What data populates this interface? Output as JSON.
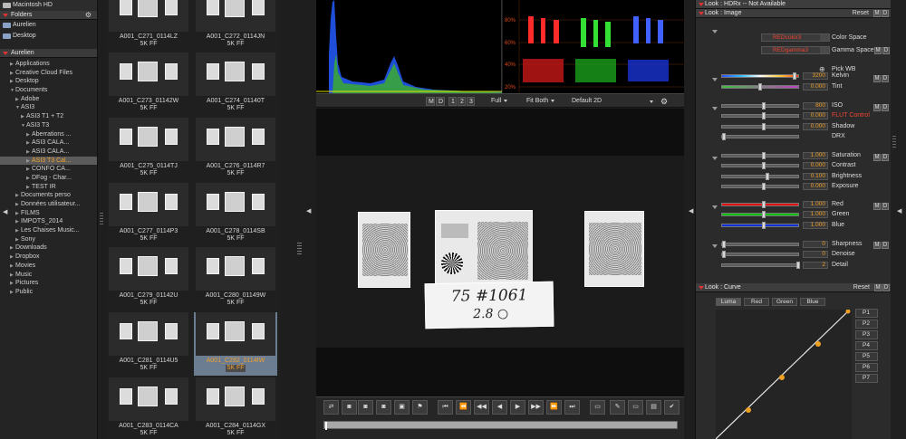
{
  "left": {
    "folders_title": "Folders",
    "volumes": [
      "Macintosh HD",
      "Aurelien",
      "Desktop"
    ],
    "user_title": "Aurelien",
    "tree": [
      {
        "label": "Applications",
        "indent": 1,
        "arrow": "▶"
      },
      {
        "label": "Creative Cloud Files",
        "indent": 1,
        "arrow": "▶"
      },
      {
        "label": "Desktop",
        "indent": 1,
        "arrow": "▶"
      },
      {
        "label": "Documents",
        "indent": 1,
        "arrow": "▼"
      },
      {
        "label": "Adobe",
        "indent": 2,
        "arrow": "▶"
      },
      {
        "label": "ASI3",
        "indent": 2,
        "arrow": "▼"
      },
      {
        "label": "ASI3 T1 + T2",
        "indent": 3,
        "arrow": "▶"
      },
      {
        "label": "ASI3 T3",
        "indent": 3,
        "arrow": "▼"
      },
      {
        "label": "Aberrations ...",
        "indent": 4,
        "arrow": "▶"
      },
      {
        "label": "ASI3 CALA...",
        "indent": 4,
        "arrow": "▶"
      },
      {
        "label": "ASI3 CALA...",
        "indent": 4,
        "arrow": "▶"
      },
      {
        "label": "ASI3 T3 Cal...",
        "indent": 4,
        "arrow": "▶",
        "selected": true
      },
      {
        "label": "CONFO CA...",
        "indent": 4,
        "arrow": "▶"
      },
      {
        "label": "DFog - Char...",
        "indent": 4,
        "arrow": "▶"
      },
      {
        "label": "TEST IR",
        "indent": 4,
        "arrow": "▶"
      },
      {
        "label": "Documents perso",
        "indent": 2,
        "arrow": "▶"
      },
      {
        "label": "Données utilisateur...",
        "indent": 2,
        "arrow": "▶"
      },
      {
        "label": "FILMS",
        "indent": 2,
        "arrow": "▶"
      },
      {
        "label": "IMPOTS_2014",
        "indent": 2,
        "arrow": "▶"
      },
      {
        "label": "Les Chaises Music...",
        "indent": 2,
        "arrow": "▶"
      },
      {
        "label": "Sony",
        "indent": 2,
        "arrow": "▶"
      },
      {
        "label": "Downloads",
        "indent": 1,
        "arrow": "▶"
      },
      {
        "label": "Dropbox",
        "indent": 1,
        "arrow": "▶"
      },
      {
        "label": "Movies",
        "indent": 1,
        "arrow": "▶"
      },
      {
        "label": "Music",
        "indent": 1,
        "arrow": "▶"
      },
      {
        "label": "Pictures",
        "indent": 1,
        "arrow": "▶"
      },
      {
        "label": "Public",
        "indent": 1,
        "arrow": "▶"
      }
    ]
  },
  "thumbs": [
    {
      "name": "A001_C271_0114LZ",
      "fmt": "5K FF"
    },
    {
      "name": "A001_C272_0114JN",
      "fmt": "5K FF"
    },
    {
      "name": "A001_C273_01142W",
      "fmt": "5K FF"
    },
    {
      "name": "A001_C274_01140T",
      "fmt": "5K FF"
    },
    {
      "name": "A001_C275_0114TJ",
      "fmt": "5K FF"
    },
    {
      "name": "A001_C276_0114R7",
      "fmt": "5K FF"
    },
    {
      "name": "A001_C277_0114P3",
      "fmt": "5K FF"
    },
    {
      "name": "A001_C278_0114SB",
      "fmt": "5K FF"
    },
    {
      "name": "A001_C279_01142U",
      "fmt": "5K FF"
    },
    {
      "name": "A001_C280_01149W",
      "fmt": "5K FF"
    },
    {
      "name": "A001_C281_0114U5",
      "fmt": "5K FF"
    },
    {
      "name": "A001_C282_0114IW",
      "fmt": "5K FF",
      "selected": true
    },
    {
      "name": "A001_C283_0114CA",
      "fmt": "5K FF"
    },
    {
      "name": "A001_C284_0114GX",
      "fmt": "5K FF"
    }
  ],
  "scopes": {
    "parade_ticks": [
      "80%",
      "60%",
      "40%",
      "20%"
    ]
  },
  "toolbar": {
    "m": "M",
    "d": "D",
    "n1": "1",
    "n2": "2",
    "n3": "3",
    "zoom": "Full",
    "fit": "Fit Both",
    "layout": "Default 2D"
  },
  "viewer": {
    "slate_line1": "75 #1061",
    "slate_line2": "2.8 ○"
  },
  "right": {
    "hdrx_title": "Look : HDRx -- Not Available",
    "image_title": "Look : Image",
    "curve_title": "Look : Curve",
    "reset": "Reset",
    "m": "M",
    "d": "D",
    "color_space_value": "REDcolor3",
    "color_space_label": "Color Space",
    "gamma_value": "REDgamma3",
    "gamma_label": "Gamma Space",
    "pick_wb": "Pick WB",
    "params": [
      {
        "label": "Kelvin",
        "value": "3200"
      },
      {
        "label": "Tint",
        "value": "0.000"
      },
      {
        "label": "ISO",
        "value": "800"
      },
      {
        "label": "FLUT Control",
        "value": "0.000",
        "red": true
      },
      {
        "label": "Shadow",
        "value": "0.000"
      },
      {
        "label": "DRX",
        "value": ""
      },
      {
        "label": "Saturation",
        "value": "1.000"
      },
      {
        "label": "Contrast",
        "value": "0.000"
      },
      {
        "label": "Brightness",
        "value": "0.100"
      },
      {
        "label": "Exposure",
        "value": "0.000"
      },
      {
        "label": "Red",
        "value": "1.000"
      },
      {
        "label": "Green",
        "value": "1.000"
      },
      {
        "label": "Blue",
        "value": "1.000"
      },
      {
        "label": "Sharpness",
        "value": "0"
      },
      {
        "label": "Denoise",
        "value": "0"
      },
      {
        "label": "Detail",
        "value": "2"
      }
    ],
    "curve_tabs": [
      "Luma",
      "Red",
      "Green",
      "Blue"
    ],
    "points": [
      "P1",
      "P2",
      "P3",
      "P4",
      "P5",
      "P6",
      "P7"
    ]
  }
}
